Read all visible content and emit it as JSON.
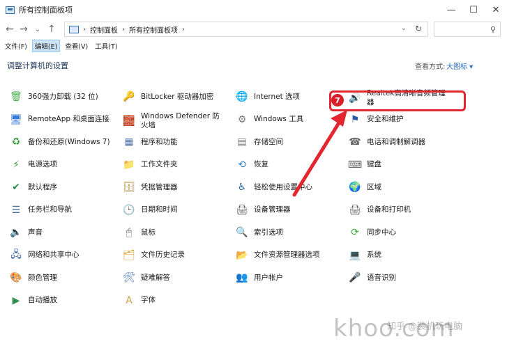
{
  "window": {
    "title": "所有控制面板项",
    "minimize": "—",
    "maximize": "☐",
    "close": "✕"
  },
  "nav": {
    "back": "←",
    "forward": "→",
    "dropdown": "⌄",
    "up": "↑",
    "breadcrumbs": [
      "控制面板",
      "所有控制面板项"
    ],
    "crumb_sep": "›",
    "address_dropdown": "⌄",
    "refresh": "↻",
    "search_icon": "⚲"
  },
  "menu": [
    "文件(F)",
    "编辑(E)",
    "查看(V)",
    "工具(T)"
  ],
  "header": {
    "title": "调整计算机的设置",
    "view_by_label": "查看方式:",
    "view_by_value": "大图标 ▾"
  },
  "items": [
    {
      "label": "360强力卸载 (32 位)",
      "icon": "uninstall-icon",
      "glyph": "🗑",
      "color": "#4caf50"
    },
    {
      "label": "BitLocker 驱动器加密",
      "icon": "key-icon",
      "glyph": "🔑",
      "color": "#c9a24a"
    },
    {
      "label": "Internet 选项",
      "icon": "globe-icon",
      "glyph": "🌐",
      "color": "#2e7bd6"
    },
    {
      "label": "Realtek高清晰音频管理器",
      "icon": "audio-manager-icon",
      "glyph": "🔊",
      "color": "#1f3f8a"
    },
    {
      "label": "RemoteApp 和桌面连接",
      "icon": "remote-desktop-icon",
      "glyph": "🖥",
      "color": "#3a7bd5"
    },
    {
      "label": "Windows Defender 防火墙",
      "icon": "firewall-icon",
      "glyph": "🧱",
      "color": "#a0522d"
    },
    {
      "label": "Windows 工具",
      "icon": "gear-icon",
      "glyph": "⚙",
      "color": "#7a7a7a"
    },
    {
      "label": "安全和维护",
      "icon": "flag-icon",
      "glyph": "⚑",
      "color": "#2a5caa"
    },
    {
      "label": "备份和还原(Windows 7)",
      "icon": "backup-icon",
      "glyph": "♻",
      "color": "#3f9c3f"
    },
    {
      "label": "程序和功能",
      "icon": "programs-icon",
      "glyph": "▦",
      "color": "#5577aa"
    },
    {
      "label": "存储空间",
      "icon": "storage-icon",
      "glyph": "▤",
      "color": "#777777"
    },
    {
      "label": "电话和调制解调器",
      "icon": "phone-icon",
      "glyph": "☎",
      "color": "#666666"
    },
    {
      "label": "电源选项",
      "icon": "power-icon",
      "glyph": "⚡",
      "color": "#3a9a3a"
    },
    {
      "label": "工作文件夹",
      "icon": "folder-icon",
      "glyph": "📁",
      "color": "#e2b23a"
    },
    {
      "label": "恢复",
      "icon": "recovery-icon",
      "glyph": "⟲",
      "color": "#2d7fc1"
    },
    {
      "label": "键盘",
      "icon": "keyboard-icon",
      "glyph": "⌨",
      "color": "#666666"
    },
    {
      "label": "默认程序",
      "icon": "default-programs-icon",
      "glyph": "✔",
      "color": "#2f8f4e"
    },
    {
      "label": "凭据管理器",
      "icon": "credentials-icon",
      "glyph": "🗄",
      "color": "#b08a3a"
    },
    {
      "label": "轻松使用设置中心",
      "icon": "accessibility-icon",
      "glyph": "♿",
      "color": "#1f5ea8"
    },
    {
      "label": "区域",
      "icon": "region-icon",
      "glyph": "🌍",
      "color": "#2e8b57"
    },
    {
      "label": "任务栏和导航",
      "icon": "taskbar-icon",
      "glyph": "☰",
      "color": "#4a6fa5"
    },
    {
      "label": "日期和时间",
      "icon": "clock-icon",
      "glyph": "🕒",
      "color": "#3c7fc4"
    },
    {
      "label": "设备管理器",
      "icon": "device-manager-icon",
      "glyph": "🖨",
      "color": "#555555"
    },
    {
      "label": "设备和打印机",
      "icon": "printer-icon",
      "glyph": "🖨",
      "color": "#555555"
    },
    {
      "label": "声音",
      "icon": "speaker-icon",
      "glyph": "🔈",
      "color": "#777777"
    },
    {
      "label": "鼠标",
      "icon": "mouse-icon",
      "glyph": "🖱",
      "color": "#666666"
    },
    {
      "label": "索引选项",
      "icon": "index-icon",
      "glyph": "🔍",
      "color": "#777777"
    },
    {
      "label": "同步中心",
      "icon": "sync-icon",
      "glyph": "⟳",
      "color": "#3aa63a"
    },
    {
      "label": "网络和共享中心",
      "icon": "network-icon",
      "glyph": "🖧",
      "color": "#2c5aa0"
    },
    {
      "label": "文件历史记录",
      "icon": "file-history-icon",
      "glyph": "🗂",
      "color": "#d9a32b"
    },
    {
      "label": "文件资源管理器选项",
      "icon": "explorer-options-icon",
      "glyph": "📂",
      "color": "#e2b23a"
    },
    {
      "label": "系统",
      "icon": "system-icon",
      "glyph": "💻",
      "color": "#2e7bd6"
    },
    {
      "label": "颜色管理",
      "icon": "color-icon",
      "glyph": "🎨",
      "color": "#c0503a"
    },
    {
      "label": "疑难解答",
      "icon": "troubleshoot-icon",
      "glyph": "🛠",
      "color": "#3d6fb5"
    },
    {
      "label": "用户帐户",
      "icon": "users-icon",
      "glyph": "👥",
      "color": "#6b8e23"
    },
    {
      "label": "语音识别",
      "icon": "microphone-icon",
      "glyph": "🎤",
      "color": "#777777"
    },
    {
      "label": "自动播放",
      "icon": "autoplay-icon",
      "glyph": "▶",
      "color": "#2f8f4e"
    },
    {
      "label": "字体",
      "icon": "font-icon",
      "glyph": "A",
      "color": "#c9a24a"
    }
  ],
  "annotation": {
    "badge": "7",
    "color": "#e3262f"
  },
  "watermark": {
    "main": "khoo.com",
    "sub": "知乎 @装机玩电脑"
  }
}
